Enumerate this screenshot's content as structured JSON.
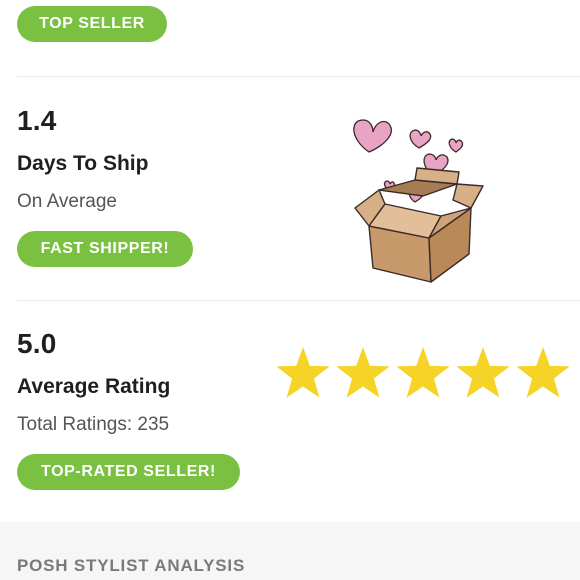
{
  "badges": {
    "top_seller": "TOP SELLER",
    "fast_shipper": "FAST SHIPPER!",
    "top_rated": "TOP-RATED SELLER!"
  },
  "shipping": {
    "value": "1.4",
    "title": "Days To Ship",
    "subtitle": "On Average"
  },
  "rating": {
    "value": "5.0",
    "title": "Average Rating",
    "total_label": "Total Ratings: 235",
    "stars_filled": 5,
    "stars_total": 5
  },
  "section": {
    "header": "POSH STYLIST ANALYSIS"
  },
  "colors": {
    "badge_green": "#7ac142",
    "star_yellow": "#f6d327",
    "heart_pink": "#e9a3c4",
    "box_brown": "#c89a6b"
  },
  "icons": {
    "shipping_illustration": "box-with-hearts-icon",
    "rating_star": "star-icon"
  }
}
